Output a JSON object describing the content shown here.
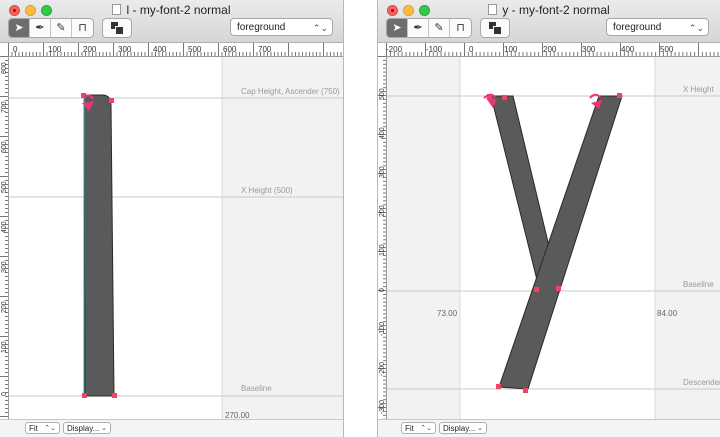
{
  "windows": [
    {
      "title": "l - my-font-2 normal",
      "layer_select": "foreground",
      "ruler_top_labels": [
        "0",
        "100",
        "200",
        "300",
        "400",
        "500",
        "600",
        "700"
      ],
      "ruler_left_labels": [
        "800",
        "700",
        "600",
        "500",
        "400",
        "300",
        "200",
        "100",
        "0"
      ],
      "guides": [
        "Cap Height, Ascender (750)",
        "X Height (500)",
        "Baseline"
      ],
      "advance_width": "270.00",
      "status_fit": "Fit",
      "status_display": "Display..."
    },
    {
      "title": "y - my-font-2 normal",
      "layer_select": "foreground",
      "ruler_top_labels": [
        "-200",
        "-100",
        "0",
        "100",
        "200",
        "300",
        "400",
        "500"
      ],
      "ruler_left_labels": [
        "500",
        "400",
        "300",
        "200",
        "100",
        "0",
        "-100",
        "-200",
        "-300"
      ],
      "guides": [
        "X Height",
        "Baseline",
        "Descender"
      ],
      "left_bearing": "73.00",
      "advance_width": "84.00",
      "status_fit": "Fit",
      "status_display": "Display..."
    }
  ],
  "tool_icons": [
    "pointer-icon",
    "pen-icon",
    "knife-icon",
    "metrics-icon"
  ],
  "colors": {
    "glyph_fill": "#5a5a5a",
    "point": "#ee4466",
    "start_arrow": "#ee3377",
    "margin_shade": "#f2f2f2",
    "guide_line": "#c8c8c8"
  }
}
